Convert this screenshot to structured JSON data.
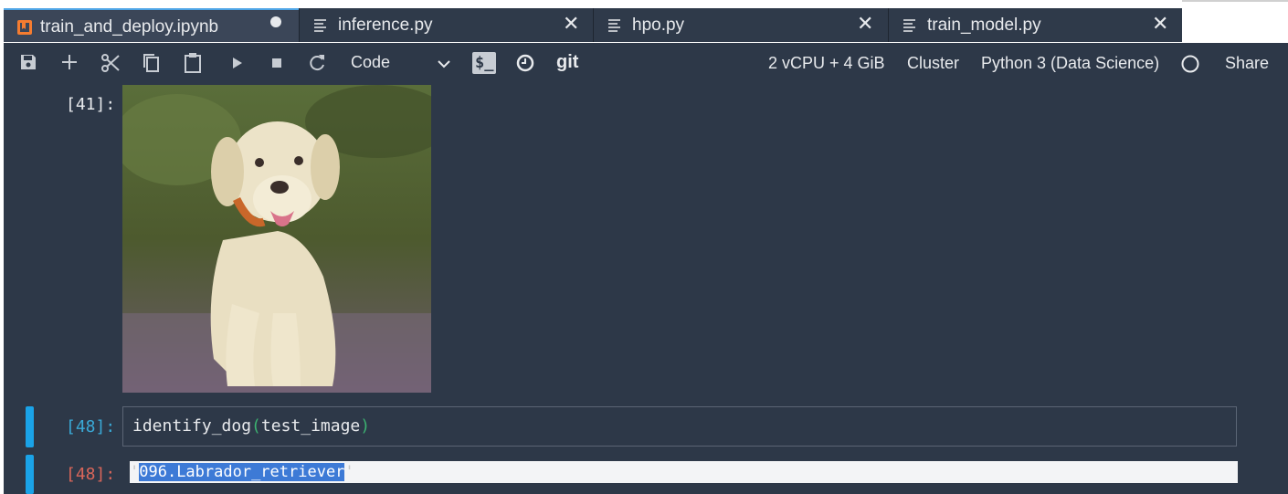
{
  "tabs": [
    {
      "label": "train_and_deploy.ipynb",
      "icon": "notebook-icon",
      "active": true,
      "unsaved": true
    },
    {
      "label": "inference.py",
      "icon": "file-text-icon",
      "active": false
    },
    {
      "label": "hpo.py",
      "icon": "file-text-icon",
      "active": false
    },
    {
      "label": "train_model.py",
      "icon": "file-text-icon",
      "active": false
    }
  ],
  "toolbar": {
    "buttons": [
      "save-icon",
      "add-icon",
      "cut-icon",
      "copy-icon",
      "paste-icon",
      "run-icon",
      "stop-icon",
      "restart-icon"
    ],
    "cell_type": "Code",
    "terminal_label": "$_",
    "git_label": "git",
    "instance": "2 vCPU + 4 GiB",
    "cluster": "Cluster",
    "kernel": "Python 3 (Data Science)",
    "share": "Share"
  },
  "cells": {
    "image_prompt": "[41]:",
    "input_prompt": "[48]:",
    "input_code": {
      "fn": "identify_dog",
      "open": "(",
      "arg": "test_image",
      "close": ")"
    },
    "output_prompt": "[48]:",
    "output_quote_open": "'",
    "output_text": "096.Labrador_retriever",
    "output_quote_close": "'"
  },
  "colors": {
    "panel": "#2d3848",
    "accent": "#1aa3e8",
    "input_prompt": "#3aa9d6",
    "output_prompt": "#d9665a"
  }
}
